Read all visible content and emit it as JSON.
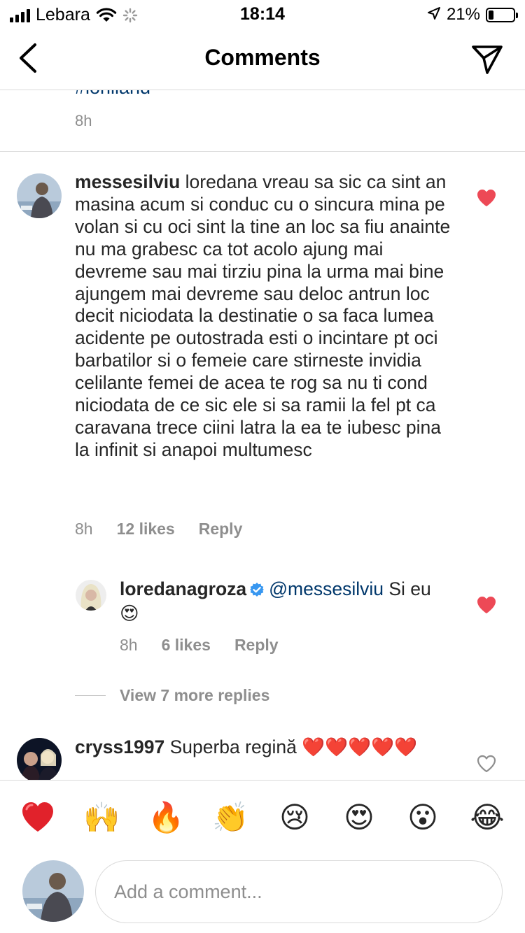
{
  "status_bar": {
    "carrier": "Lebara",
    "time": "18:14",
    "battery_percent": "21%",
    "battery_level": 0.21
  },
  "nav": {
    "title": "Comments",
    "back_icon": "chevron-left-icon",
    "send_icon": "paper-plane-icon"
  },
  "caption": {
    "tail_text": "#lorilland",
    "time": "8h"
  },
  "comments": [
    {
      "username": "messesilviu",
      "text": "loredana vreau sa sic ca sint an masina acum si conduc cu o sincura mina pe volan si cu oci sint la tine an loc sa fiu anainte nu ma grabesc ca tot acolo ajung mai devreme sau mai tirziu pina la urma mai bine ajungem mai devreme sau deloc antrun loc decit niciodata la destinatie o sa faca lumea acidente pe outostrada esti o incintare pt oci barbatilor si o femeie care stirneste invidia celilante femei de acea te rog sa nu ti cond niciodata de ce sic ele si sa ramii la fel pt ca caravana trece ciini latra la ea te iubesc pina la infinit si anapoi multumesc",
      "time": "8h",
      "likes": "12 likes",
      "reply": "Reply",
      "liked": true
    },
    {
      "username": "loredanagroza",
      "mention": "@messesilviu",
      "text": " Si eu 😍",
      "time": "8h",
      "likes": "6 likes",
      "reply": "Reply",
      "liked": true,
      "verified": true
    },
    {
      "username": "cryss1997",
      "text": "Superba regină ❤️❤️❤️❤️❤️",
      "liked": false
    }
  ],
  "view_more_replies": "View 7 more replies",
  "emoji_bar": [
    "❤️",
    "🙌",
    "🔥",
    "👏",
    "😢",
    "😍",
    "😮",
    "😂"
  ],
  "composer": {
    "placeholder": "Add a comment..."
  },
  "colors": {
    "like_red": "#ed4956",
    "link_blue": "#00376b",
    "verified_blue": "#3897f0",
    "meta_gray": "#8e8e8e"
  }
}
